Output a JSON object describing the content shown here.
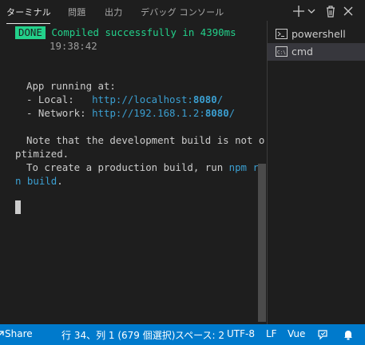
{
  "tabs": [
    {
      "label": "ターミナル",
      "active": true
    },
    {
      "label": "問題"
    },
    {
      "label": "出力"
    },
    {
      "label": "デバッグ コンソール"
    }
  ],
  "toolbar_icons": [
    "plus-icon",
    "chevron-down-icon",
    "trash-icon",
    "close-icon"
  ],
  "terminal": {
    "done_badge": "DONE",
    "compiled": "Compiled successfully in 4390ms",
    "timestamp": "19:38:42",
    "app_running": "App running at:",
    "local_prefix": "- Local:   ",
    "local_url": "http://localhost:",
    "local_port": "8080",
    "local_slash": "/",
    "network_prefix": "- Network: ",
    "network_url": "http://192.168.1.2:",
    "network_port": "8080",
    "network_slash": "/",
    "note1": "Note that the development build is not o",
    "note2": "ptimized.",
    "build1_pre": "To create a production build, run ",
    "build1_cmd": "npm ru",
    "build2_cmd": "n build",
    "build2_end": "."
  },
  "sidebar": {
    "items": [
      {
        "label": "powershell",
        "icon": "terminal-icon",
        "selected": false
      },
      {
        "label": "cmd",
        "icon": "cmd-icon",
        "selected": true
      }
    ]
  },
  "statusbar": {
    "share": "Share",
    "position": "行 34、列 1 (679 個選択)",
    "spaces": "スペース: 2",
    "encoding": "UTF-8",
    "eol": "LF",
    "language": "Vue"
  },
  "colors": {
    "accent": "#007acc",
    "green": "#23d18b",
    "link": "#3b9fd1",
    "background": "#1e1e1e"
  }
}
